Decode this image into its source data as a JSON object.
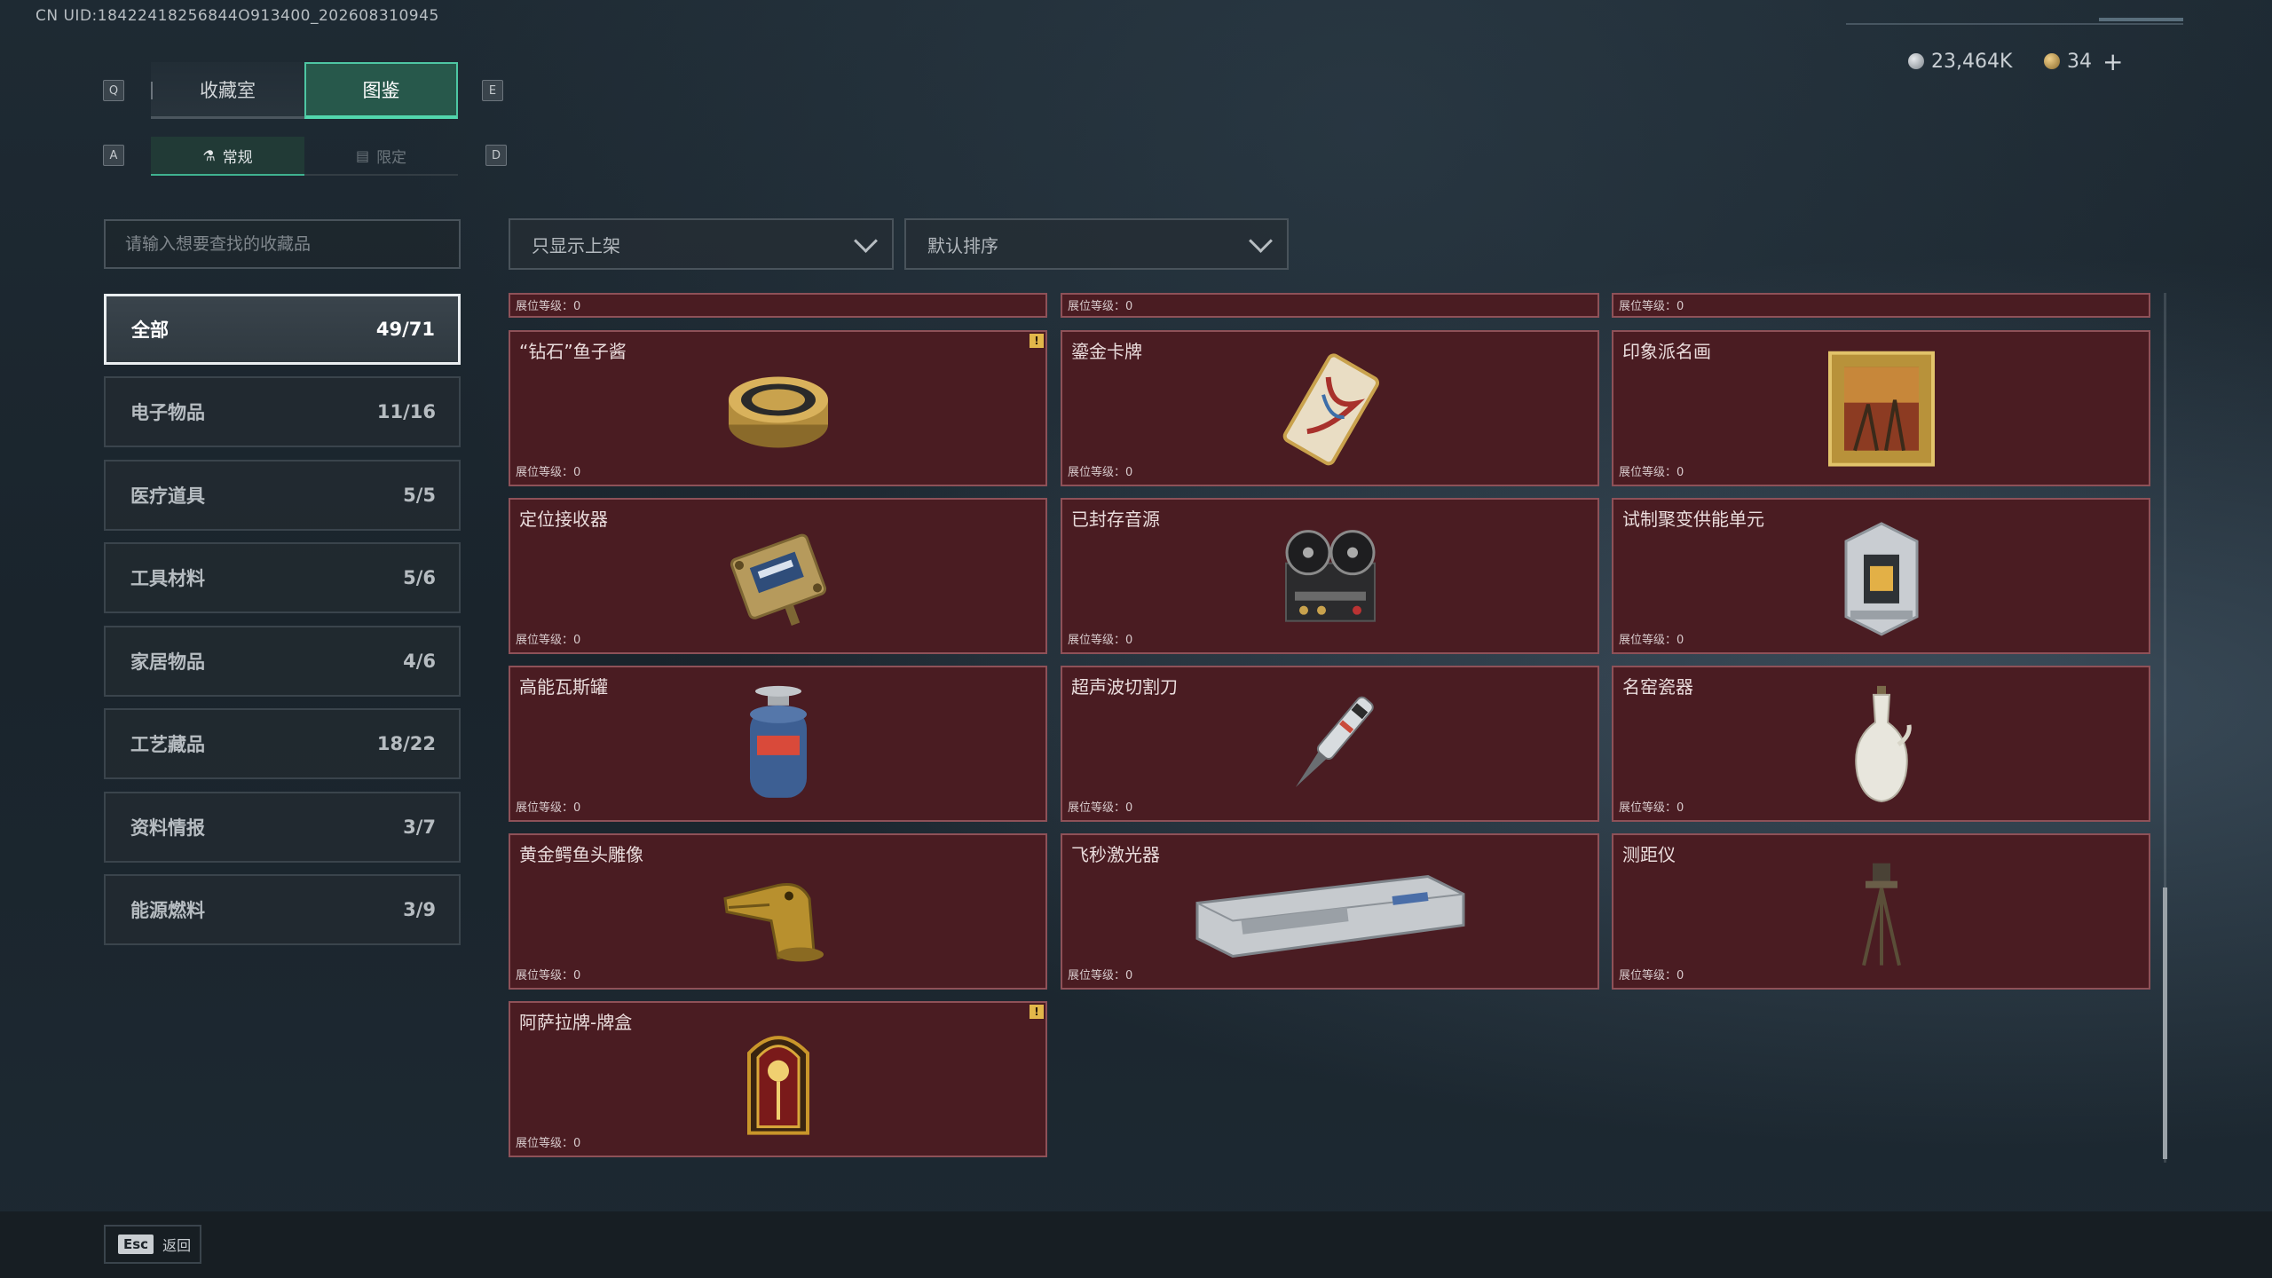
{
  "header": {
    "uid": "CN UID:18422418256844O913400_202608310945",
    "currency_silver": "23,464K",
    "currency_gold": "34",
    "plus_label": "+"
  },
  "keys": {
    "prev_tab": "Q",
    "next_tab": "E",
    "prev_sub": "A",
    "next_sub": "D"
  },
  "tabs": [
    {
      "label": "收藏室",
      "active": false
    },
    {
      "label": "图鉴",
      "active": true
    }
  ],
  "subtabs": [
    {
      "label": "常规",
      "icon": "flask-icon",
      "active": true
    },
    {
      "label": "限定",
      "icon": "image-icon",
      "active": false
    }
  ],
  "search": {
    "placeholder": "请输入想要查找的收藏品",
    "value": ""
  },
  "filters": {
    "show_filter": "只显示上架",
    "sort": "默认排序"
  },
  "categories": [
    {
      "label": "全部",
      "count": "49/71",
      "active": true
    },
    {
      "label": "电子物品",
      "count": "11/16"
    },
    {
      "label": "医疗道具",
      "count": "5/5"
    },
    {
      "label": "工具材料",
      "count": "5/6"
    },
    {
      "label": "家居物品",
      "count": "4/6"
    },
    {
      "label": "工艺藏品",
      "count": "18/22"
    },
    {
      "label": "资料情报",
      "count": "3/7"
    },
    {
      "label": "能源燃料",
      "count": "3/9"
    }
  ],
  "level_label": "展位等级：0",
  "items": [
    {
      "name": "“钻石”鱼子酱",
      "icon": "caviar-tin-icon",
      "badge": "!"
    },
    {
      "name": "鎏金卡牌",
      "icon": "gilded-card-icon"
    },
    {
      "name": "印象派名画",
      "icon": "framed-painting-icon"
    },
    {
      "name": "定位接收器",
      "icon": "receiver-device-icon"
    },
    {
      "name": "已封存音源",
      "icon": "reel-recorder-icon"
    },
    {
      "name": "试制聚变供能单元",
      "icon": "fusion-unit-icon"
    },
    {
      "name": "高能瓦斯罐",
      "icon": "gas-canister-icon"
    },
    {
      "name": "超声波切割刀",
      "icon": "ultrasonic-knife-icon"
    },
    {
      "name": "名窑瓷器",
      "icon": "porcelain-vase-icon"
    },
    {
      "name": "黄金鳄鱼头雕像",
      "icon": "crocodile-statue-icon"
    },
    {
      "name": "飞秒激光器",
      "icon": "laser-device-icon"
    },
    {
      "name": "测距仪",
      "icon": "rangefinder-tripod-icon"
    },
    {
      "name": "阿萨拉牌-牌盒",
      "icon": "card-box-icon",
      "badge": "!"
    }
  ],
  "footer": {
    "esc_key": "Esc",
    "back_label": "返回"
  }
}
